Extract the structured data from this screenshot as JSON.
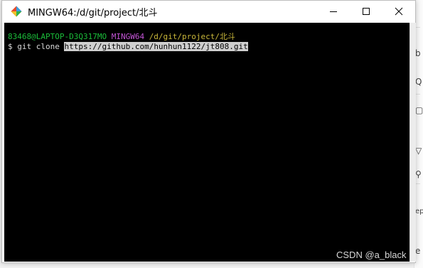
{
  "window": {
    "title": "MINGW64:/d/git/project/北斗"
  },
  "terminal": {
    "prompt_user": "83468@LAPTOP-D3Q317MO",
    "prompt_system": "MINGW64",
    "prompt_path": "/d/git/project/北斗",
    "command_prefix": "$ git clone ",
    "command_url": "https://github.com/hunhun1122/jt808.git"
  },
  "background_page": {
    "glyphs": [
      "b",
      "Q",
      "▢",
      "▽",
      "⚲",
      "ep",
      "e"
    ]
  },
  "watermark": "CSDN @a_black",
  "colors": {
    "user": "#1bbd3a",
    "system": "#c455d6",
    "path": "#c9b73a",
    "terminal_bg": "#000000",
    "selection": "#cfcfcf"
  },
  "icons": [
    "git-for-windows-icon",
    "minimize-icon",
    "maximize-icon",
    "close-icon"
  ]
}
